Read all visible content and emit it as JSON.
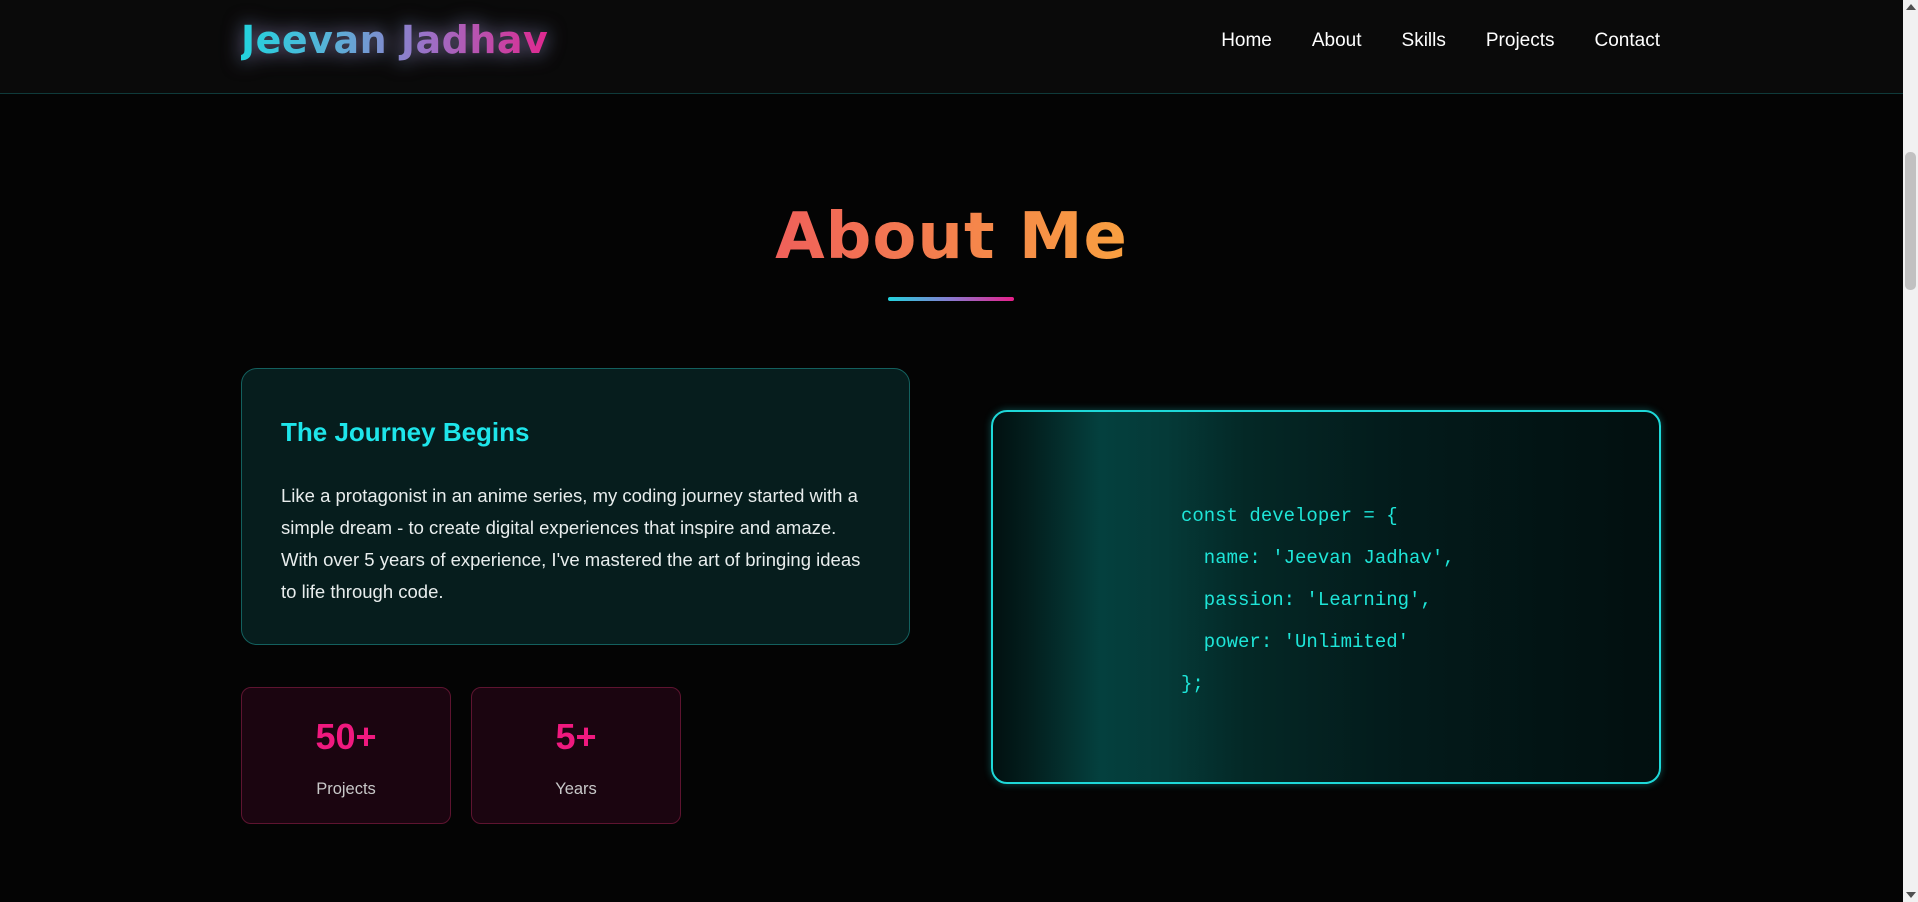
{
  "brand": {
    "name": "Jeevan Jadhav"
  },
  "nav": {
    "items": [
      {
        "label": "Home"
      },
      {
        "label": "About"
      },
      {
        "label": "Skills"
      },
      {
        "label": "Projects"
      },
      {
        "label": "Contact"
      }
    ]
  },
  "about": {
    "title": "About Me",
    "journey": {
      "title": "The Journey Begins",
      "text": "Like a protagonist in an anime series, my coding journey started with a simple dream - to create digital experiences that inspire and amaze. With over 5 years of experience, I've mastered the art of bringing ideas to life through code."
    },
    "stats": [
      {
        "value": "50+",
        "label": "Projects"
      },
      {
        "value": "5+",
        "label": "Years"
      }
    ],
    "code": {
      "lines": [
        "const developer = {",
        "  name: 'Jeevan Jadhav',",
        "  passion: 'Learning',",
        "  power: 'Unlimited'",
        "};"
      ]
    }
  },
  "colors": {
    "background": "#040404",
    "accent_cyan": "#1ee5ea",
    "accent_pink": "#f0197f",
    "title_orange": "#f5884a"
  }
}
